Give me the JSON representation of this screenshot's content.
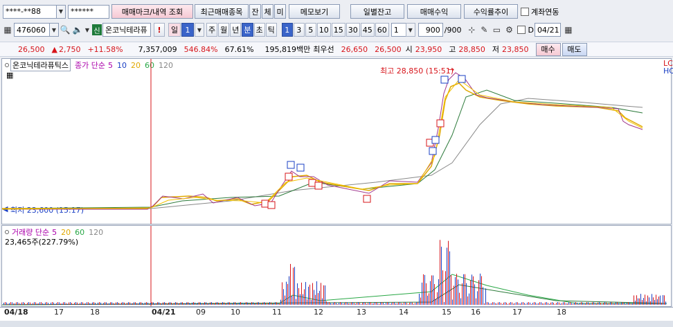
{
  "account": {
    "number": "****-**88",
    "password": "******"
  },
  "toolbar1": {
    "trade_mark_btn": "매매마크/내역 조회",
    "recent_btn": "최근매매종목",
    "jan": "잔",
    "che": "체",
    "mi": "미",
    "memo_btn": "메모보기",
    "daily_balance_btn": "일별잔고",
    "trade_profit_btn": "매매수익",
    "profit_trend_btn": "수익률추이",
    "link_label": "계좌연동"
  },
  "toolbar2": {
    "code": "476060",
    "credit_badge": "신",
    "stock_name": "온코닉테라퓨",
    "warn": "!",
    "period_day": "일",
    "period_num": "1",
    "week": "주",
    "month": "월",
    "year": "년",
    "minute": "분",
    "second": "초",
    "tick": "틱",
    "intervals": [
      "1",
      "3",
      "5",
      "10",
      "15",
      "30",
      "45",
      "60"
    ],
    "interval_select": "1",
    "count": "900",
    "count_total": "/900",
    "date": "04/21",
    "d_label": "D"
  },
  "quote": {
    "price": "26,500",
    "change": "2,750",
    "change_pct": "+11.58%",
    "volume": "7,357,009",
    "vol_ratio": "546.84%",
    "turnover": "67.61%",
    "amount": "195,819백만",
    "best_label": "최우선",
    "ask": "26,650",
    "bid": "26,500",
    "open_label": "시",
    "open": "23,950",
    "high_label": "고",
    "high": "28,850",
    "low_label": "저",
    "low": "23,850",
    "buy_btn": "매수",
    "sell_btn": "매도"
  },
  "price_panel": {
    "stock": "온코닉테라퓨틱스",
    "legend_title": "종가 단순",
    "ma": [
      "5",
      "10",
      "20",
      "60",
      "120"
    ],
    "high_note": "최고 28,850 (15:51)",
    "low_note": "최저 23,600 (15:17)",
    "right_labels": [
      "LC",
      "HC"
    ]
  },
  "volume_panel": {
    "legend_title": "거래량 단순",
    "ma": [
      "5",
      "20",
      "60",
      "120"
    ],
    "value": "23,465주(227.79%)"
  },
  "dates": [
    "04/18",
    "17",
    "18",
    "04/21",
    "09",
    "10",
    "11",
    "12",
    "13",
    "14",
    "15",
    "16",
    "17",
    "18"
  ],
  "colors": {
    "ma5": "#e0a800",
    "ma20": "#28a745",
    "ma60": "#2c7a3a",
    "ma120": "#888888",
    "up": "#d7141a",
    "down": "#1a3fc4",
    "accent": "#3a64c9"
  }
}
